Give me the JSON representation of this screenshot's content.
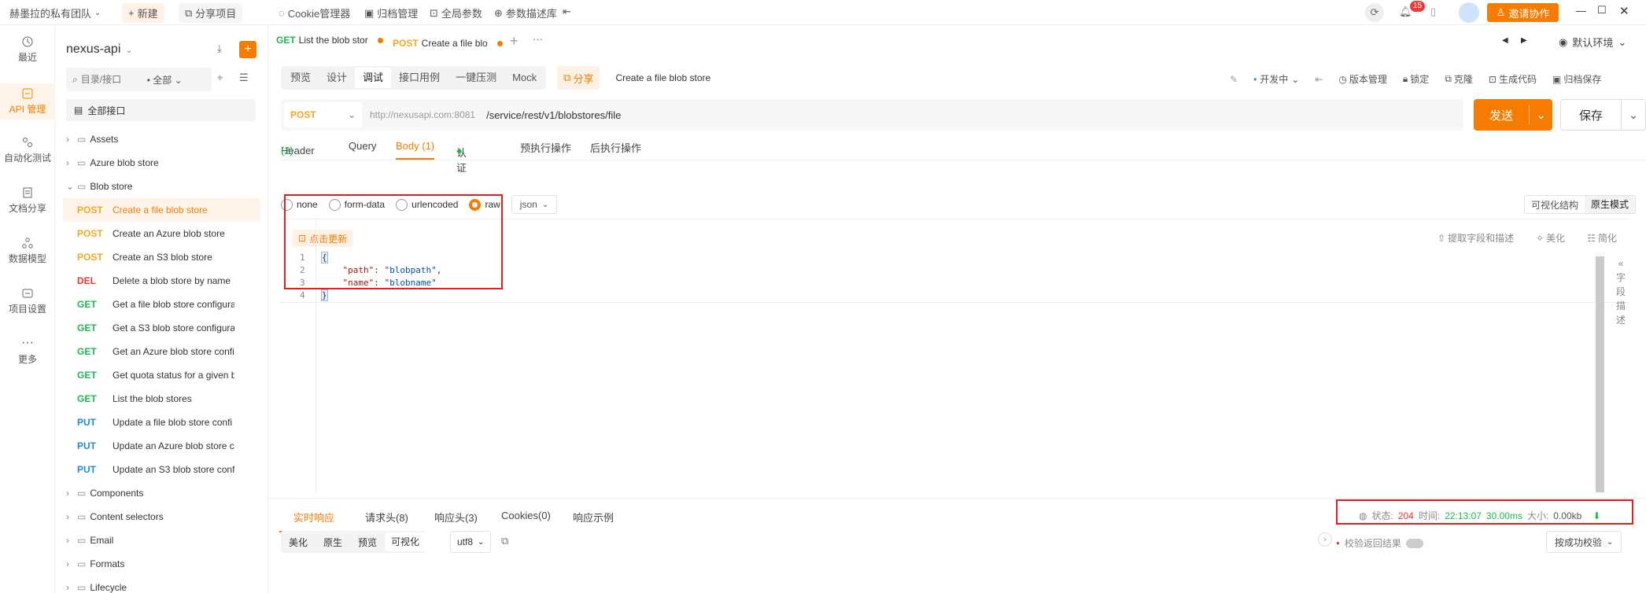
{
  "topbar": {
    "team": "赫墨拉的私有团队",
    "new_label": "新建",
    "share_project": "分享项目",
    "cookie_manager": "Cookie管理器",
    "archive_manager": "归档管理",
    "global_params": "全局参数",
    "params_library": "参数描述库",
    "notification_count": "15",
    "invite_label": "邀请协作"
  },
  "nav": {
    "items": [
      {
        "label": "最近"
      },
      {
        "label": "API 管理"
      },
      {
        "label": "自动化测试"
      },
      {
        "label": "文档分享"
      },
      {
        "label": "数据模型"
      },
      {
        "label": "项目设置"
      },
      {
        "label": "更多"
      }
    ]
  },
  "tree": {
    "project": "nexus-api",
    "search_placeholder": "目录/接口",
    "filter": "全部",
    "all_endpoints": "全部接口",
    "folders": {
      "assets": "Assets",
      "azure": "Azure blob store",
      "blob": "Blob store",
      "components": "Components",
      "content_selectors": "Content selectors",
      "email": "Email",
      "formats": "Formats",
      "lifecycle": "Lifecycle"
    },
    "endpoints": [
      {
        "method": "POST",
        "name": "Create a file blob store"
      },
      {
        "method": "POST",
        "name": "Create an Azure blob store"
      },
      {
        "method": "POST",
        "name": "Create an S3 blob store"
      },
      {
        "method": "DEL",
        "name": "Delete a blob store by name"
      },
      {
        "method": "GET",
        "name": "Get a file blob store configura"
      },
      {
        "method": "GET",
        "name": "Get a S3 blob store configura"
      },
      {
        "method": "GET",
        "name": "Get an Azure blob store confi"
      },
      {
        "method": "GET",
        "name": "Get quota status for a given b"
      },
      {
        "method": "GET",
        "name": "List the blob stores"
      },
      {
        "method": "PUT",
        "name": "Update a file blob store confi"
      },
      {
        "method": "PUT",
        "name": "Update an Azure blob store c"
      },
      {
        "method": "PUT",
        "name": "Update an S3 blob store conf"
      }
    ]
  },
  "tabs": [
    {
      "method": "GET",
      "name": "List the blob stor"
    },
    {
      "method": "POST",
      "name": "Create a file blo"
    }
  ],
  "env": "默认环境",
  "modes": [
    "预览",
    "设计",
    "调试",
    "接口用例",
    "一键压测",
    "Mock"
  ],
  "share_label": "分享",
  "api_title": "Create a file blob store",
  "toolbar_right": {
    "branch": "开发中",
    "version": "版本管理",
    "lock": "锁定",
    "clone": "克隆",
    "gen_code": "生成代码",
    "archive": "归档保存"
  },
  "request": {
    "method": "POST",
    "host": "http://nexusapi.com:8081",
    "path": "/service/rest/v1/blobstores/file",
    "send": "发送",
    "save": "保存"
  },
  "req_tabs": {
    "header": "Header",
    "header_count": "(2)",
    "query": "Query",
    "body": "Body (1)",
    "auth": "认证",
    "pre": "预执行操作",
    "post": "后执行操作"
  },
  "body_types": [
    "none",
    "form-data",
    "urlencoded",
    "raw"
  ],
  "body_format": "json",
  "view_modes": {
    "visual": "可视化结构",
    "raw": "原生模式"
  },
  "update_label": "点击更新",
  "editor_tools": {
    "extract": "提取字段和描述",
    "beautify": "美化",
    "simplify": "简化"
  },
  "side_label": "字段描述",
  "code": {
    "l1": "{",
    "l2_key": "\"path\"",
    "l2_val": "\"blobpath\"",
    "l3_key": "\"name\"",
    "l3_val": "\"blobname\"",
    "l4": "}"
  },
  "response": {
    "tabs": {
      "realtime": "实时响应",
      "req_headers": "请求头(8)",
      "resp_headers": "响应头(3)",
      "cookies": "Cookies(0)",
      "example": "响应示例"
    },
    "status_label": "状态:",
    "status": "204",
    "time_label": "时间:",
    "time": "22:13:07",
    "duration": "30.00ms",
    "size_label": "大小:",
    "size": "0.00kb",
    "view_tabs": [
      "美化",
      "原生",
      "预览",
      "可视化"
    ],
    "encoding": "utf8",
    "validate": "校验返回结果",
    "validate_mode": "按成功校验"
  },
  "colors": {
    "accent": "#f57c00",
    "highlight_box": "#e02020"
  }
}
